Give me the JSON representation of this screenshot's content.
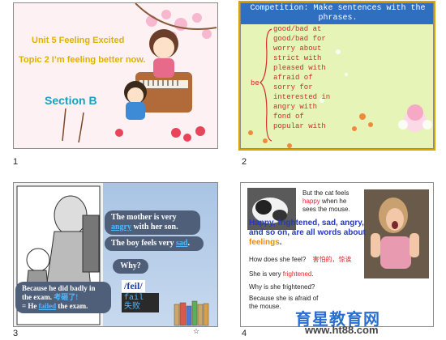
{
  "slides": [
    {
      "number": "1",
      "title_line1": "Unit 5 Feeling Excited",
      "title_line2": "Topic 2 I’m feeling better now.",
      "section": "Section B"
    },
    {
      "number": "2",
      "header": "Competition: Make sentences with the phrases.",
      "be_label": "be",
      "phrases": [
        "good/bad at",
        "good/bad for",
        "worry about",
        "strict with",
        "pleased with",
        "afraid of",
        "sorry for",
        "interested in",
        "angry with",
        "fond of",
        "popular with"
      ]
    },
    {
      "number": "3",
      "bubble1_a": "The mother is very",
      "bubble1_word": "angry",
      "bubble1_b": " with her son.",
      "bubble2_a": "The boy feels very ",
      "bubble2_word": "sad",
      "bubble2_b": ".",
      "bubble3": "Why?",
      "bubble4_line1": "Because he did badly in",
      "bubble4_line2": "the exam.",
      "bubble4_note": "考砸了!",
      "bubble4_eq": "=",
      "bubble4_line3_a": "He ",
      "bubble4_line3_word": "failed",
      "bubble4_line3_b": " the exam.",
      "phonetic": "/feil/",
      "word": "fail",
      "word_meaning": "失败",
      "comic_caption": "一个…"
    },
    {
      "number": "4",
      "cat_line1": "But the cat feels",
      "cat_line2_word": "happy",
      "cat_line2_b": " when he",
      "cat_line3": "sees the mouse.",
      "big_text_a": "Happy, frightened, sad, angry, and so on, are all words about ",
      "big_text_word": "feelings",
      "big_text_b": ".",
      "q1": "How does she feel?",
      "q1_note": "害怕的，惊诶",
      "a1_a": "She is very ",
      "a1_word": "frightened",
      "a1_b": ".",
      "q2": "Why is she frightened?",
      "a2_line1": "Because she is afraid of",
      "a2_line2": "the mouse."
    }
  ],
  "watermark_cn": "育星教育网",
  "watermark_url": "www.ht88.com",
  "colors": {
    "slide2_bg": "#e7f4b8",
    "slide2_header": "#2f6fbf",
    "phrase_red": "#d8262b",
    "bubble_bg": "#4f5f79",
    "highlight_blue": "#4fb8ff",
    "feeling_blue": "#2437c9",
    "selection": "#d9a400"
  }
}
